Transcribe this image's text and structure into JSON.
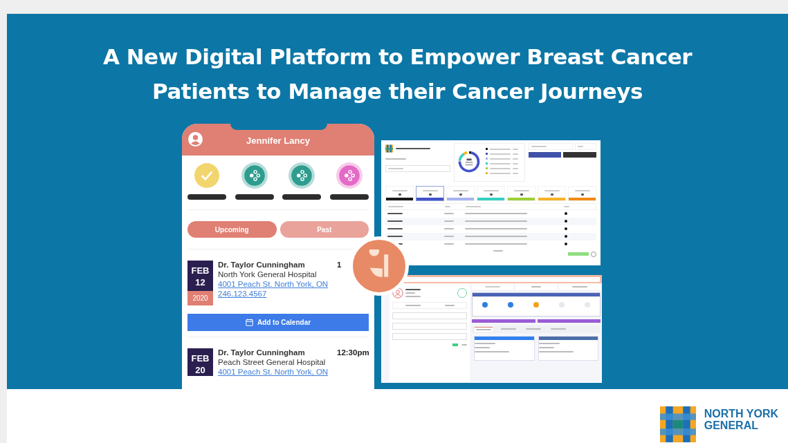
{
  "headline": [
    "A New Digital Platform to Empower Breast Cancer",
    "Patients to Manage their Cancer Journeys"
  ],
  "phone": {
    "user_name": "Jennifer Lancy",
    "steps": [
      {
        "kind": "done",
        "color": "#f3d56e"
      },
      {
        "kind": "pending",
        "color": "#2e9c8e"
      },
      {
        "kind": "pending",
        "color": "#2e9c8e"
      },
      {
        "kind": "pending",
        "color": "#e46ac6"
      }
    ],
    "tabs": [
      {
        "label": "Upcoming",
        "selected": true
      },
      {
        "label": "Past",
        "selected": false
      }
    ],
    "appointments": [
      {
        "month": "FEB",
        "day": "12",
        "year": "2020",
        "doctor": "Dr. Taylor Cunningham",
        "time": "1",
        "hospital": "North York General Hospital",
        "address": "4001 Peach St. North York, ON",
        "phone": "246.123.4567",
        "button": "Add to Calendar"
      },
      {
        "month": "FEB",
        "day": "20",
        "doctor": "Dr. Taylor Cunningham",
        "time": "12:30pm",
        "hospital": "Peach Street General Hospital",
        "address": "4001 Peach St. North York, ON"
      }
    ]
  },
  "dashboard": {
    "legend": [
      {
        "color": "#1b1b1b"
      },
      {
        "color": "#4352c9"
      },
      {
        "color": "#a7b2ee"
      },
      {
        "color": "#35cfc3"
      },
      {
        "color": "#9ccf36"
      },
      {
        "color": "#f6b128"
      }
    ],
    "stages": [
      {
        "color": "#1b1b1b",
        "selected": false
      },
      {
        "color": "#4352c9",
        "selected": true
      },
      {
        "color": "#a7b2ee",
        "selected": false
      },
      {
        "color": "#35cfc3",
        "selected": false
      },
      {
        "color": "#9ccf36",
        "selected": false
      },
      {
        "color": "#f6b128",
        "selected": false
      },
      {
        "color": "#f08a14",
        "selected": false
      }
    ]
  },
  "profile": {
    "nodes": [
      {
        "color": "#2f7fe0"
      },
      {
        "color": "#2f7fe0"
      },
      {
        "color": "#f4a21d"
      },
      {
        "color": "#e6e9ef"
      },
      {
        "color": "#e6e9ef"
      }
    ],
    "tabs": [
      {
        "selected": true
      },
      {
        "selected": false
      },
      {
        "selected": false
      },
      {
        "selected": false
      }
    ],
    "cards": [
      {
        "color": "#2f80ed"
      },
      {
        "color": "#4b6ea8"
      }
    ]
  },
  "org": [
    "NORTH YORK",
    "GENERAL"
  ]
}
